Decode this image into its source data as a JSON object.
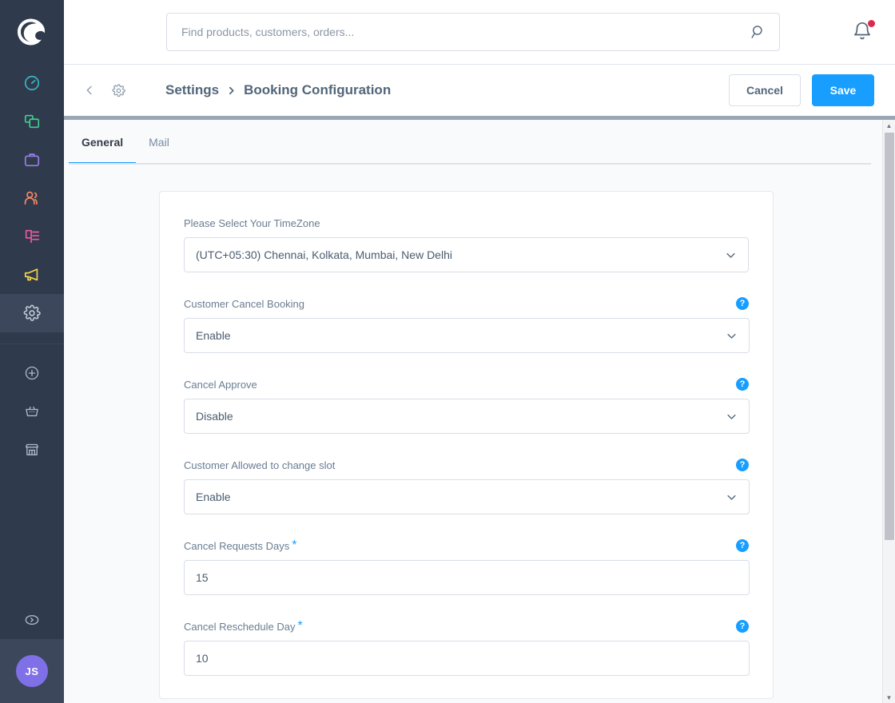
{
  "brand": {
    "logo_name": "shopware-logo",
    "accent_blue": "#189eff",
    "sidebar_bg": "#303a4d",
    "avatar_bg": "#8070e8"
  },
  "sidebar": {
    "items": [
      {
        "icon": "dashboard-gauge-icon",
        "name": "dashboard",
        "color": "#37b8c4",
        "active": false
      },
      {
        "icon": "catalogues-layers-icon",
        "name": "catalogues",
        "color": "#3ecf8e",
        "active": false
      },
      {
        "icon": "orders-briefcase-icon",
        "name": "orders",
        "color": "#9b7fe8",
        "active": false
      },
      {
        "icon": "customers-users-icon",
        "name": "customers",
        "color": "#f88962",
        "active": false
      },
      {
        "icon": "content-list-icon",
        "name": "content",
        "color": "#ec5ba3",
        "active": false
      },
      {
        "icon": "marketing-megaphone-icon",
        "name": "marketing",
        "color": "#f5d949",
        "active": false
      },
      {
        "icon": "settings-gear-icon",
        "name": "settings",
        "color": "#bcc7d3",
        "active": true
      }
    ],
    "secondary_items": [
      {
        "icon": "add-plus-circle-icon",
        "name": "add"
      },
      {
        "icon": "basket-icon",
        "name": "basket"
      },
      {
        "icon": "store-icon",
        "name": "store"
      }
    ],
    "help_icon": "help-chevron-circle-icon",
    "avatar_initials": "JS"
  },
  "topbar": {
    "search": {
      "placeholder": "Find products, customers, orders...",
      "value": "",
      "icon": "search-icon"
    },
    "notifications": {
      "icon": "bell-icon",
      "has_unread": true,
      "dot_color": "#de294c"
    }
  },
  "smartbar": {
    "back_icon": "chevron-left-icon",
    "module_icon": "settings-gear-icon",
    "breadcrumb": {
      "parent": "Settings",
      "separator_icon": "chevron-right-icon",
      "current": "Booking Configuration"
    },
    "cancel_label": "Cancel",
    "save_label": "Save"
  },
  "tabs": [
    {
      "label": "General",
      "active": true
    },
    {
      "label": "Mail",
      "active": false
    }
  ],
  "form": {
    "fields": [
      {
        "label": "Please Select Your TimeZone",
        "type": "select",
        "value": "(UTC+05:30) Chennai, Kolkata, Mumbai, New Delhi",
        "required": false,
        "has_help": false,
        "wide": true
      },
      {
        "label": "Customer Cancel Booking",
        "type": "select",
        "value": "Enable",
        "required": false,
        "has_help": true,
        "wide": false
      },
      {
        "label": "Cancel Approve",
        "type": "select",
        "value": "Disable",
        "required": false,
        "has_help": true,
        "wide": false
      },
      {
        "label": "Customer Allowed to change slot",
        "type": "select",
        "value": "Enable",
        "required": false,
        "has_help": true,
        "wide": false
      },
      {
        "label": "Cancel Requests Days",
        "type": "number",
        "value": "15",
        "required": true,
        "has_help": true,
        "wide": false
      },
      {
        "label": "Cancel Reschedule Day",
        "type": "number",
        "value": "10",
        "required": true,
        "has_help": true,
        "wide": false
      }
    ],
    "required_marker": "*",
    "help_glyph": "?",
    "chevron_icon": "chevron-down-icon"
  },
  "scrollbar": {
    "up_arrow_icon": "scroll-up-arrow-icon",
    "down_arrow_icon": "scroll-down-arrow-icon",
    "thumb_name": "vertical-scrollbar-thumb"
  }
}
